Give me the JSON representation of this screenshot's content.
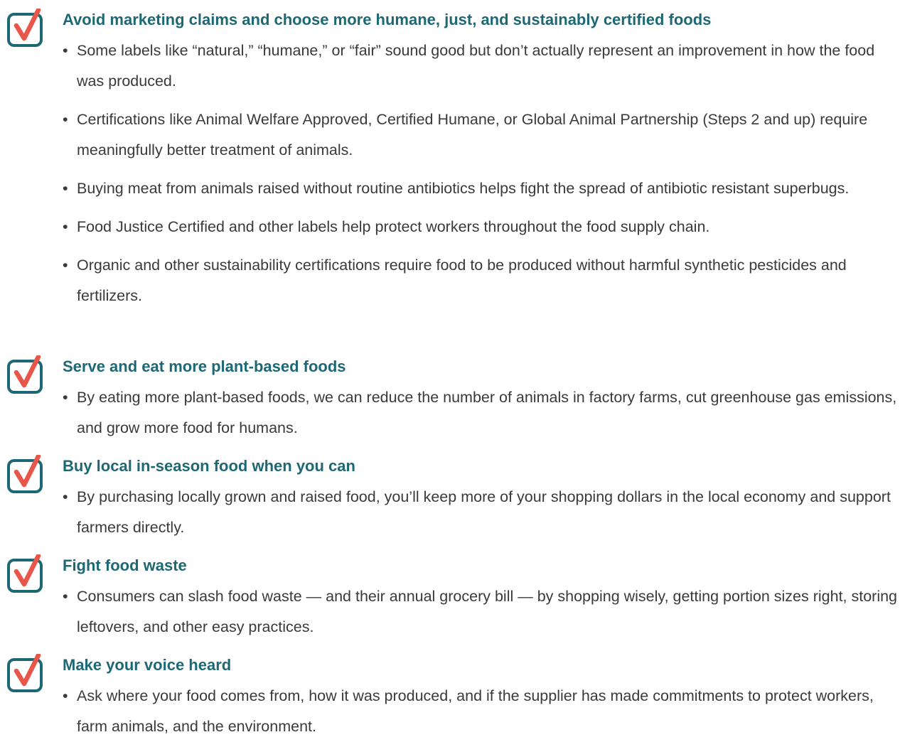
{
  "colors": {
    "heading": "#1d6874",
    "body_text": "#3a3a3a",
    "checkbox_border": "#1d6874",
    "checkmark": "#e8564a"
  },
  "sections": [
    {
      "heading": "Avoid marketing claims and choose more humane, just, and sustainably certified foods",
      "bullets": [
        "Some labels like “natural,” “humane,” or “fair” sound good but don’t actually represent an improvement in how the food was produced.",
        "Certifications like Animal Welfare Approved, Certified Humane, or Global Animal Partnership (Steps 2 and up) require meaningfully better treatment of animals.",
        "Buying meat from animals raised without routine antibiotics helps fight the spread of antibiotic resistant superbugs.",
        "Food Justice Certified and other labels help protect workers throughout the food supply chain.",
        "Organic and other sustainability certifications require food to be produced without harmful synthetic pesticides and fertilizers."
      ]
    },
    {
      "heading": "Serve and eat more plant-based foods",
      "bullets": [
        "By eating more plant-based foods, we can reduce the number of animals in factory farms, cut greenhouse gas emissions, and grow more food for humans."
      ]
    },
    {
      "heading": "Buy local in-season food when you can",
      "bullets": [
        "By purchasing locally grown and raised food, you’ll keep more of your shopping dollars in the local economy and support farmers directly."
      ]
    },
    {
      "heading": "Fight food waste",
      "bullets": [
        "Consumers can slash food waste — and their annual grocery bill — by shopping wisely, getting portion sizes right, storing leftovers, and other easy practices."
      ]
    },
    {
      "heading": "Make your voice heard",
      "bullets": [
        "Ask where your food comes from, how it was produced, and if the supplier has made commitments to protect workers, farm animals, and the environment."
      ]
    }
  ]
}
